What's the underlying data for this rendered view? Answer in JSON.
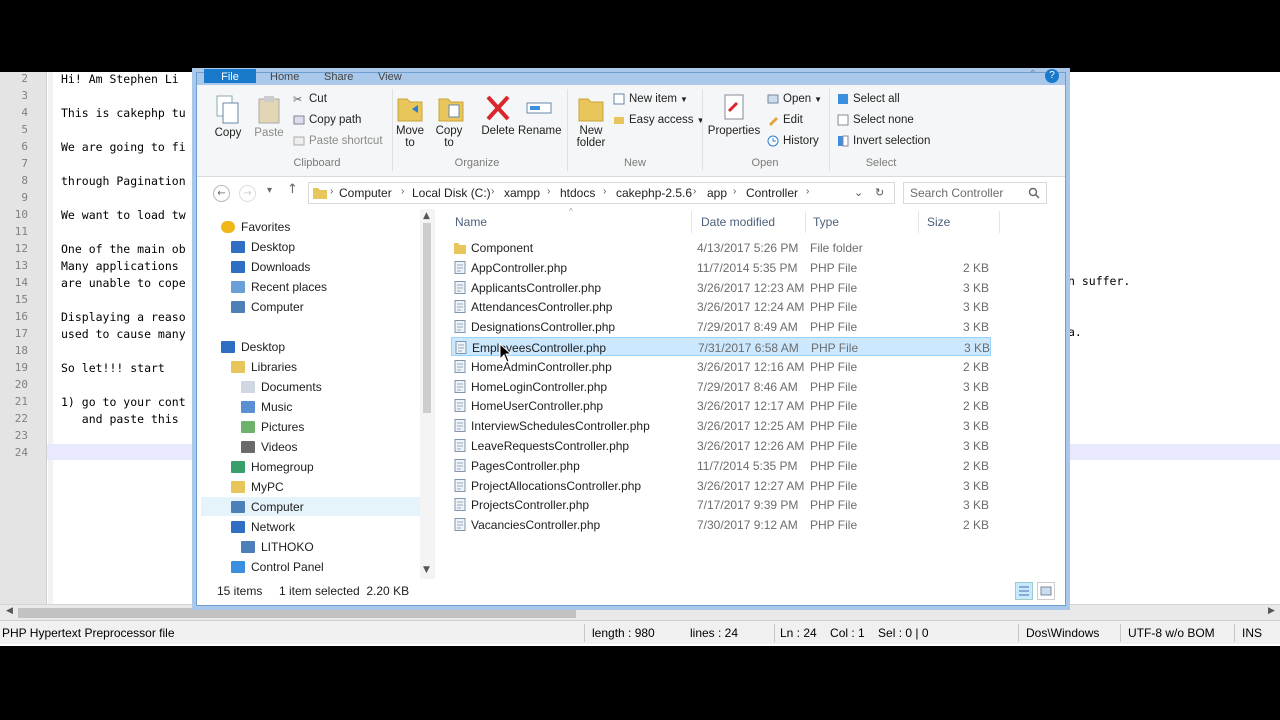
{
  "editor": {
    "lines": [
      {
        "num": "2",
        "text": "Hi! Am Stephen Li"
      },
      {
        "num": "3",
        "text": ""
      },
      {
        "num": "4",
        "text": "This is cakephp tu"
      },
      {
        "num": "5",
        "text": ""
      },
      {
        "num": "6",
        "text": "We are going to fi"
      },
      {
        "num": "7",
        "text": ""
      },
      {
        "num": "8",
        "text": "through Pagination"
      },
      {
        "num": "9",
        "text": ""
      },
      {
        "num": "10",
        "text": "We want to load tw"
      },
      {
        "num": "11",
        "text": ""
      },
      {
        "num": "12",
        "text": "One of the main ob"
      },
      {
        "num": "13",
        "text": "Many applications"
      },
      {
        "num": "14",
        "text": "are unable to cope"
      },
      {
        "num": "15",
        "text": ""
      },
      {
        "num": "16",
        "text": "Displaying a reaso"
      },
      {
        "num": "17",
        "text": "used to cause many"
      },
      {
        "num": "18",
        "text": ""
      },
      {
        "num": "19",
        "text": "So let!!! start"
      },
      {
        "num": "20",
        "text": ""
      },
      {
        "num": "21",
        "text": "1) go to your cont"
      },
      {
        "num": "22",
        "text": "   and paste this"
      },
      {
        "num": "23",
        "text": ""
      },
      {
        "num": "24",
        "text": ""
      }
    ],
    "right_text_1": "n suffer.",
    "right_text_2": "a.",
    "status": {
      "file_type": "PHP Hypertext Preprocessor file",
      "length": "length : 980",
      "lines": "lines : 24",
      "position": "Ln : 24    Col : 1    Sel : 0 | 0",
      "eol": "Dos\\Windows",
      "encoding": "UTF-8 w/o BOM",
      "mode": "INS"
    }
  },
  "explorer": {
    "tabs": [
      "File",
      "Home",
      "Share",
      "View"
    ],
    "ribbon": {
      "copy": "Copy",
      "paste": "Paste",
      "cut": "Cut",
      "copy_path": "Copy path",
      "paste_shortcut": "Paste shortcut",
      "move_to": "Move to",
      "copy_to": "Copy to",
      "delete": "Delete",
      "rename": "Rename",
      "new_folder": "New folder",
      "new_item": "New item",
      "easy_access": "Easy access",
      "properties": "Properties",
      "open": "Open",
      "edit": "Edit",
      "history": "History",
      "select_all": "Select all",
      "select_none": "Select none",
      "invert_selection": "Invert selection",
      "groups": [
        "Clipboard",
        "Organize",
        "New",
        "Open",
        "Select"
      ]
    },
    "address": {
      "crumbs": [
        "Computer",
        "Local Disk (C:)",
        "xampp",
        "htdocs",
        "cakephp-2.5.6",
        "app",
        "Controller"
      ]
    },
    "search": {
      "placeholder": "Search Controller"
    },
    "nav": [
      {
        "label": "Favorites",
        "icon": "star-icon"
      },
      {
        "label": "Desktop",
        "icon": "desktop-icon"
      },
      {
        "label": "Downloads",
        "icon": "downloads-icon"
      },
      {
        "label": "Recent places",
        "icon": "recent-icon"
      },
      {
        "label": "Computer",
        "icon": "computer-icon"
      },
      {
        "label": "Desktop",
        "icon": "desktop-icon"
      },
      {
        "label": "Libraries",
        "icon": "libraries-icon"
      },
      {
        "label": "Documents",
        "icon": "documents-icon"
      },
      {
        "label": "Music",
        "icon": "music-icon"
      },
      {
        "label": "Pictures",
        "icon": "pictures-icon"
      },
      {
        "label": "Videos",
        "icon": "videos-icon"
      },
      {
        "label": "Homegroup",
        "icon": "homegroup-icon"
      },
      {
        "label": "MyPC",
        "icon": "folder-icon"
      },
      {
        "label": "Computer",
        "icon": "computer-icon"
      },
      {
        "label": "Network",
        "icon": "network-icon"
      },
      {
        "label": "LITHOKO",
        "icon": "pc-icon"
      },
      {
        "label": "Control Panel",
        "icon": "control-panel-icon"
      }
    ],
    "columns": {
      "name": "Name",
      "date": "Date modified",
      "type": "Type",
      "size": "Size"
    },
    "files": [
      {
        "name": "Component",
        "date": "4/13/2017 5:26 PM",
        "type": "File folder",
        "size": "",
        "folder": true
      },
      {
        "name": "AppController.php",
        "date": "11/7/2014 5:35 PM",
        "type": "PHP File",
        "size": "2 KB"
      },
      {
        "name": "ApplicantsController.php",
        "date": "3/26/2017 12:23 AM",
        "type": "PHP File",
        "size": "3 KB"
      },
      {
        "name": "AttendancesController.php",
        "date": "3/26/2017 12:24 AM",
        "type": "PHP File",
        "size": "3 KB"
      },
      {
        "name": "DesignationsController.php",
        "date": "7/29/2017 8:49 AM",
        "type": "PHP File",
        "size": "3 KB"
      },
      {
        "name": "EmployeesController.php",
        "date": "7/31/2017 6:58 AM",
        "type": "PHP File",
        "size": "3 KB",
        "selected": true
      },
      {
        "name": "HomeAdminController.php",
        "date": "3/26/2017 12:16 AM",
        "type": "PHP File",
        "size": "2 KB"
      },
      {
        "name": "HomeLoginController.php",
        "date": "7/29/2017 8:46 AM",
        "type": "PHP File",
        "size": "3 KB"
      },
      {
        "name": "HomeUserController.php",
        "date": "3/26/2017 12:17 AM",
        "type": "PHP File",
        "size": "2 KB"
      },
      {
        "name": "InterviewSchedulesController.php",
        "date": "3/26/2017 12:25 AM",
        "type": "PHP File",
        "size": "3 KB"
      },
      {
        "name": "LeaveRequestsController.php",
        "date": "3/26/2017 12:26 AM",
        "type": "PHP File",
        "size": "3 KB"
      },
      {
        "name": "PagesController.php",
        "date": "11/7/2014 5:35 PM",
        "type": "PHP File",
        "size": "2 KB"
      },
      {
        "name": "ProjectAllocationsController.php",
        "date": "3/26/2017 12:27 AM",
        "type": "PHP File",
        "size": "3 KB"
      },
      {
        "name": "ProjectsController.php",
        "date": "7/17/2017 9:39 PM",
        "type": "PHP File",
        "size": "3 KB"
      },
      {
        "name": "VacanciesController.php",
        "date": "7/30/2017 9:12 AM",
        "type": "PHP File",
        "size": "2 KB"
      }
    ],
    "status": {
      "count": "15 items",
      "selection": "1 item selected  2.20 KB"
    }
  },
  "colors": {
    "accent": "#1979ca",
    "selection": "#cce8ff",
    "folder": "#e8c65c"
  }
}
